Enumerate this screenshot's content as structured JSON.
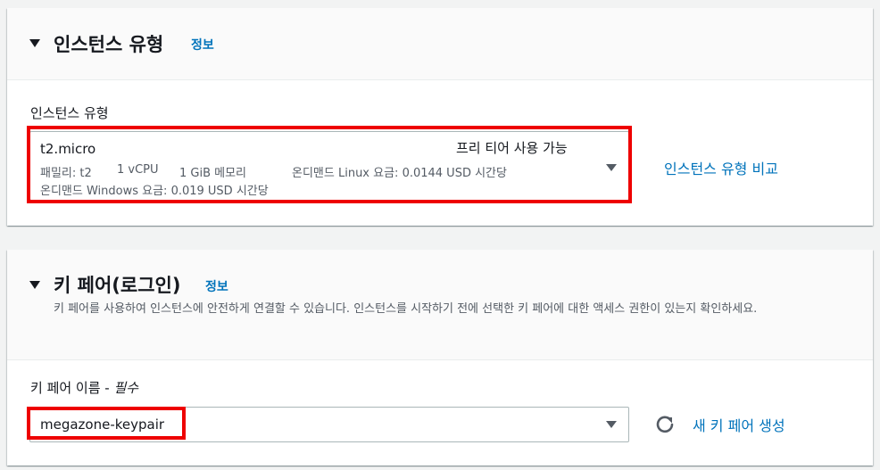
{
  "instance_panel": {
    "title": "인스턴스 유형",
    "info_link": "정보",
    "field_label": "인스턴스 유형",
    "selected": {
      "name": "t2.micro",
      "badge": "프리 티어 사용 가능",
      "family": "패밀리: t2",
      "vcpu": "1 vCPU",
      "memory": "1 GiB 메모리",
      "linux_price": "온디맨드 Linux 요금: 0.0144 USD 시간당",
      "windows_price": "온디맨드 Windows 요금: 0.019 USD 시간당"
    },
    "compare_link": "인스턴스 유형 비교"
  },
  "keypair_panel": {
    "title": "키 페어(로그인)",
    "info_link": "정보",
    "description": "키 페어를 사용하여 인스턴스에 안전하게 연결할 수 있습니다. 인스턴스를 시작하기 전에 선택한 키 페어에 대한 액세스 권한이 있는지 확인하세요.",
    "field_label": "키 페어 이름 - ",
    "field_required": "필수",
    "selected_value": "megazone-keypair",
    "create_link": "새 키 페어 생성"
  },
  "colors": {
    "link": "#0073bb",
    "highlight": "#ee0000",
    "background": "#f2f3f3"
  }
}
